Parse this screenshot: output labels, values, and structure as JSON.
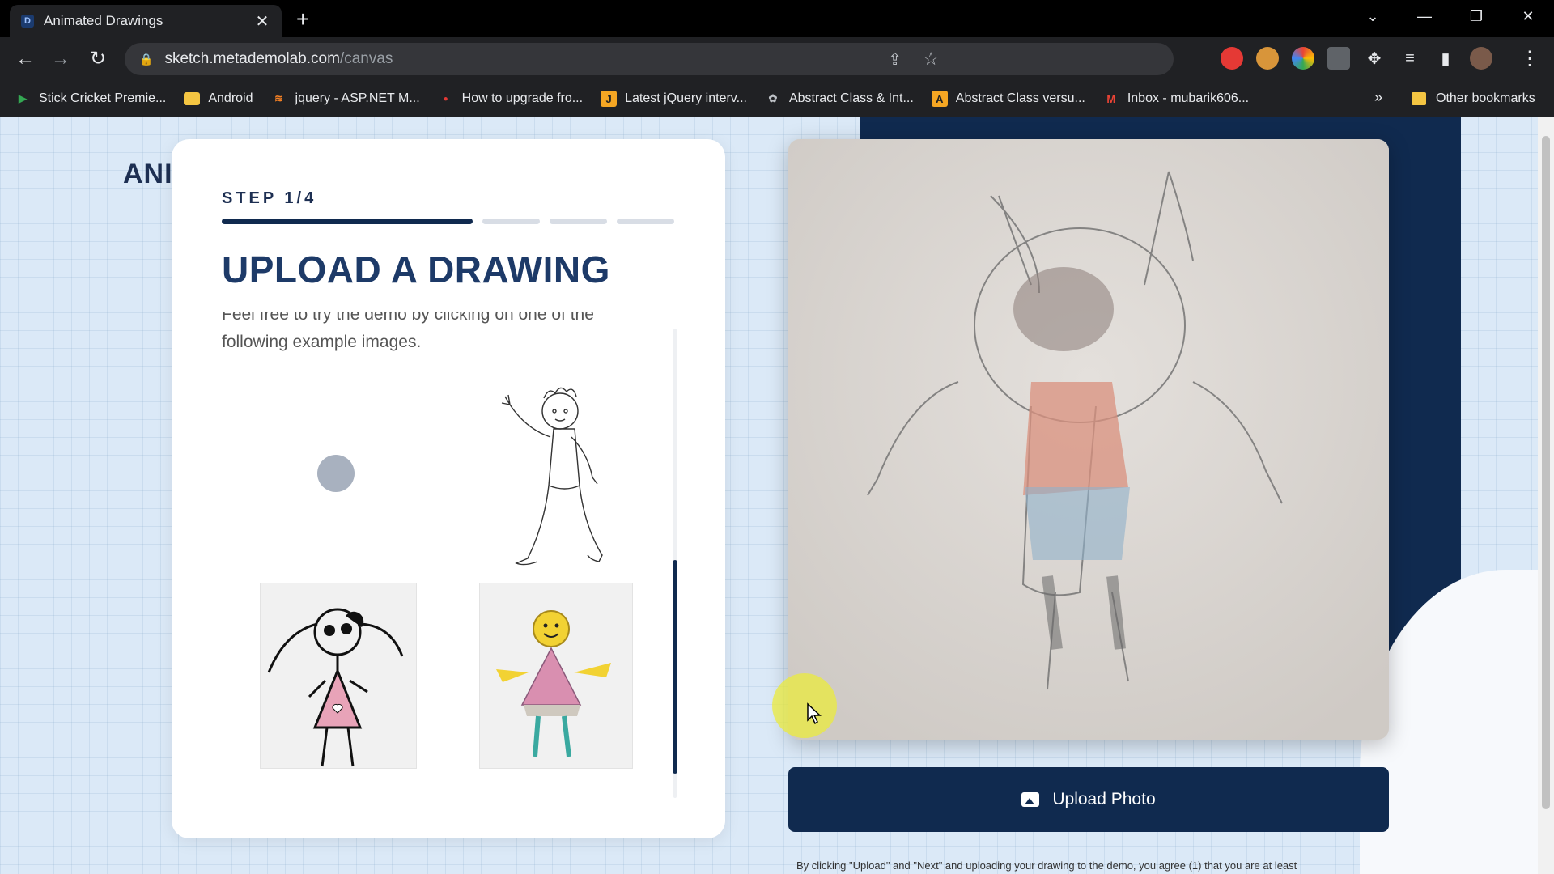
{
  "browser": {
    "tab_title": "Animated Drawings",
    "favicon_letter": "D",
    "url_host": "sketch.metademolab.com",
    "url_path": "/canvas",
    "bookmarks": [
      {
        "label": "Stick Cricket Premie...",
        "icon": "play-icon",
        "color": "#34a853"
      },
      {
        "label": "Android",
        "icon": "folder-icon",
        "color": "#f4c542"
      },
      {
        "label": "jquery - ASP.NET M...",
        "icon": "stackoverflow-icon",
        "color": "#f48024"
      },
      {
        "label": "How to upgrade fro...",
        "icon": "red-dot-icon",
        "color": "#e53935"
      },
      {
        "label": "Latest jQuery interv...",
        "icon": "site-icon",
        "color": "#f5a623"
      },
      {
        "label": "Abstract Class & Int...",
        "icon": "site-icon",
        "color": "#9aa0a6"
      },
      {
        "label": "Abstract Class versu...",
        "icon": "site-icon",
        "color": "#f5a623"
      },
      {
        "label": "Inbox - mubarik606...",
        "icon": "gmail-icon",
        "color": "#ea4335"
      }
    ],
    "more_bookmarks": "»",
    "other_bookmarks": "Other bookmarks"
  },
  "page": {
    "brand_partial": "ANI",
    "step_label": "STEP 1/4",
    "heading": "UPLOAD A DRAWING",
    "description_line1": "Feel free to try the demo by clicking on one of the",
    "description_line2": "following example images.",
    "upload_button": "Upload Photo",
    "disclaimer": "By clicking \"Upload\" and \"Next\" and uploading your drawing to the demo, you agree (1) that you are at least"
  },
  "progress": {
    "current_step": 1,
    "total_steps": 4
  },
  "colors": {
    "navy": "#102a4f",
    "heading": "#1d3a68",
    "page_bg": "#dbe9f7"
  }
}
